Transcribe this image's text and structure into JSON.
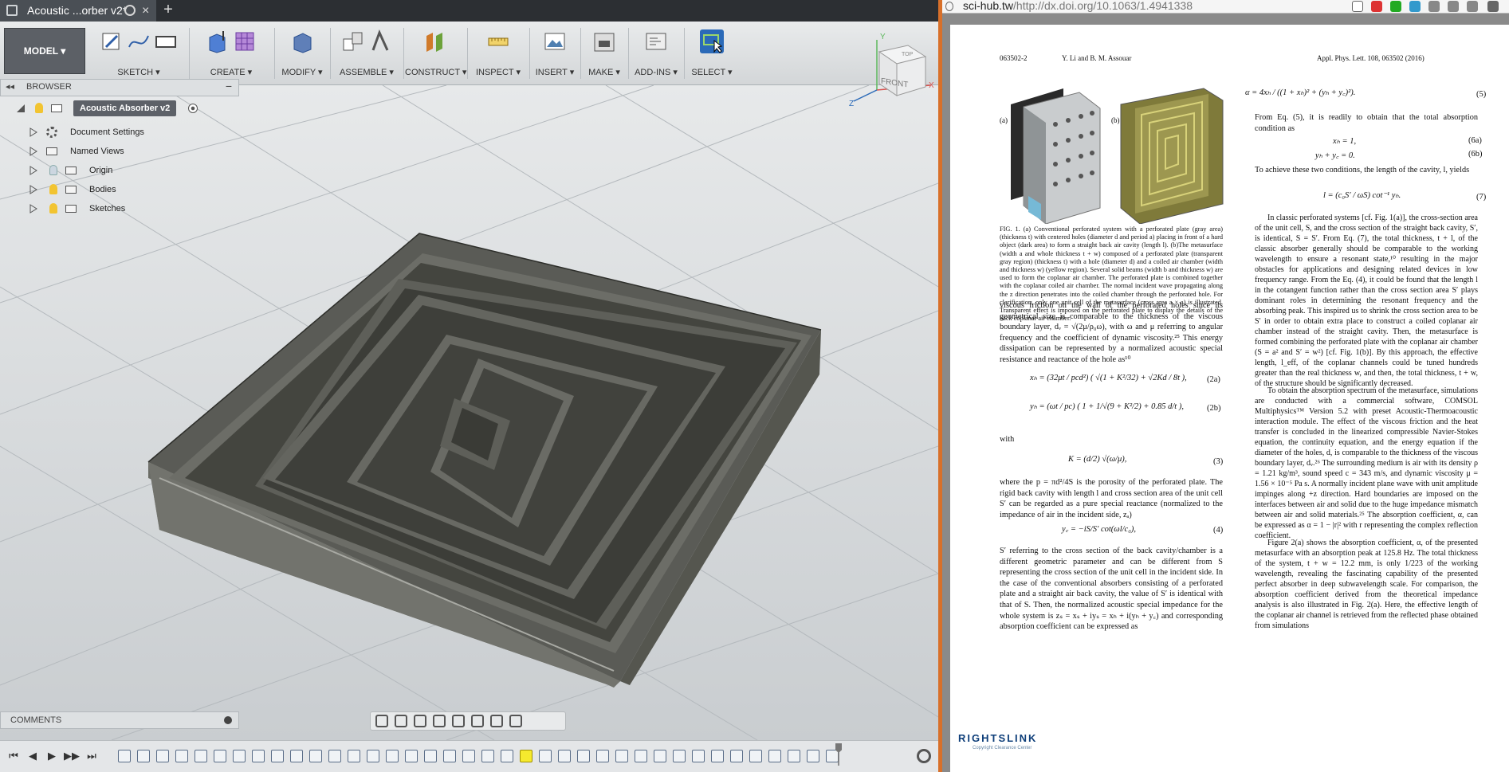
{
  "fusion": {
    "doc_tab_title": "Acoustic ...orber v2*",
    "new_tab": "+",
    "close_glyph": "×",
    "workspace": "MODEL ▾",
    "toolbar_groups": [
      {
        "id": "sketch",
        "label": "SKETCH ▾",
        "color": "#3a66b0"
      },
      {
        "id": "create",
        "label": "CREATE ▾",
        "color": "#4f7fd4"
      },
      {
        "id": "modify",
        "label": "MODIFY ▾",
        "color": "#5f7fb8"
      },
      {
        "id": "assemble",
        "label": "ASSEMBLE ▾",
        "color": "#6e7c8a"
      },
      {
        "id": "construct",
        "label": "CONSTRUCT ▾",
        "color": "#d07a2a"
      },
      {
        "id": "inspect",
        "label": "INSPECT ▾",
        "color": "#c89a2a"
      },
      {
        "id": "insert",
        "label": "INSERT ▾",
        "color": "#4f7fb0"
      },
      {
        "id": "make",
        "label": "MAKE ▾",
        "color": "#555d66"
      },
      {
        "id": "addins",
        "label": "ADD-INS ▾",
        "color": "#555d66"
      },
      {
        "id": "select",
        "label": "SELECT ▾",
        "color": "#2b6ab8"
      }
    ],
    "viewcube": {
      "face": "FRONT",
      "top": "TOP",
      "axis_x": "X",
      "axis_y": "Y",
      "axis_z": "Z"
    },
    "browser": {
      "label": "BROWSER",
      "collapse_glyph": "◂◂",
      "minus_glyph": "−",
      "root": "Acoustic Absorber v2",
      "items": [
        {
          "label": "Document Settings"
        },
        {
          "label": "Named Views"
        },
        {
          "label": "Origin"
        },
        {
          "label": "Bodies"
        },
        {
          "label": "Sketches"
        }
      ]
    },
    "comments_label": "COMMENTS",
    "timeline": {
      "first": "⏮",
      "prev": "◀",
      "play": "▶",
      "next": "▶▶",
      "last": "⏭"
    }
  },
  "pdf": {
    "url_host": "sci-hub.tw",
    "url_rest": "/http://dx.doi.org/10.1063/1.4941338",
    "header_left": "063502-2",
    "header_authors": "Y. Li and B. M. Assouar",
    "header_right": "Appl. Phys. Lett. 108, 063502 (2016)",
    "fig_label_a": "(a)",
    "fig_label_b": "(b)",
    "caption": "FIG. 1. (a) Conventional perforated system with a perforated plate (gray area) (thickness t) with centered holes (diameter d and period a) placing in front of a hard object (dark area) to form a straight back air cavity (length l). (b)The metasurface (width a and whole thickness t + w) composed of a perforated plate (transparent gray region) (thickness t) with a hole (diameter d) and a coiled air chamber (width and thickness w) (yellow region). Several solid beams (width b and thickness w) are used to form the coplanar air chamber. The perforated plate is combined together with the coplanar coiled air chamber. The normal incident wave propagating along the z direction penetrates into the coiled chamber through the perforated hole. For clarification, only one unit cell of the metasurface (cross area a × a) is illustrated. Transparent effect is imposed on the perforated plate to display the details of the back coplanar air chamber.",
    "left_p1": "viscous friction on the wall of the perforated holes since its geometrical size is comparable to the thickness of the viscous boundary layer, dᵥ = √(2μ/ρ₀ω), with ω and μ referring to angular frequency and the coefficient of dynamic viscosity.²⁵ This energy dissipation can be represented by a normalized acoustic special resistance and reactance of the hole as¹⁰",
    "eq2a": "xₕ = (32μt / pcd²) ( √(1 + K²/32) + √2Kd / 8t ),",
    "eq2a_num": "(2a)",
    "eq2b": "yₕ = (ωt / pc) ( 1 + 1/√(9 + K²/2) + 0.85 d/t ),",
    "eq2b_num": "(2b)",
    "with": "with",
    "eq3": "K = (d/2) √(ω/μ),",
    "eq3_num": "(3)",
    "left_p2": "where the p = πd²/4S is the porosity of the perforated plate. The rigid back cavity with length l and cross section area of the unit cell S′ can be regarded as a pure special reactance (normalized to the impedance of air in the incident side, zₐ)",
    "eq4": "y꜀ = −iS/S′ cot(ωl/c₀),",
    "eq4_num": "(4)",
    "left_p3": "S′ referring to the cross section of the back cavity/chamber is a different geometric parameter and can be different from S representing the cross section of the unit cell in the incident side. In the case of the conventional absorbers consisting of a perforated plate and a straight air back cavity, the value of S′ is identical with that of S. Then, the normalized acoustic special impedance for the whole system is zₛ = xₛ + iyₛ = xₕ + i(yₕ + y꜀) and corresponding absorption coefficient can be expressed as",
    "eq5": "α = 4xₕ / ((1 + xₕ)² + (yₕ + y꜀)²).",
    "eq5_num": "(5)",
    "right_p1": "From Eq. (5), it is readily to obtain that the total absorption condition as",
    "eq6a": "xₕ = 1,",
    "eq6a_num": "(6a)",
    "eq6b": "yₕ + y꜀ = 0.",
    "eq6b_num": "(6b)",
    "right_p2": "To achieve these two conditions, the length of the cavity, l, yields",
    "eq7": "l = (c₀S′ / ωS) cot⁻¹ yₕ.",
    "eq7_num": "(7)",
    "right_p3": "In classic perforated systems [cf. Fig. 1(a)], the cross-section area of the unit cell, S, and the cross section of the straight back cavity, S′, is identical, S = S′. From Eq. (7), the total thickness, t + l, of the classic absorber generally should be comparable to the working wavelength to ensure a resonant state,¹⁰ resulting in the major obstacles for applications and designing related devices in low frequency range. From the Eq. (4), it could be found that the length l in the cotangent function rather than the cross section area S′ plays dominant roles in determining the resonant frequency and the absorbing peak. This inspired us to shrink the cross section area to be S′ in order to obtain extra place to construct a coiled coplanar air chamber instead of the straight cavity. Then, the metasurface is formed combining the perforated plate with the coplanar air chamber (S = a² and S′ = w²) [cf. Fig. 1(b)]. By this approach, the effective length, l_eff, of the coplanar channels could be tuned hundreds greater than the real thickness w, and then, the total thickness, t + w, of the structure should be significantly decreased.",
    "right_p4": "To obtain the absorption spectrum of the metasurface, simulations are conducted with a commercial software, COMSOL Multiphysics™ Version 5.2 with preset Acoustic-Thermoacoustic interaction module. The effect of the viscous friction and the heat transfer is concluded in the linearized compressible Navier-Stokes equation, the continuity equation, and the energy equation if the diameter of the holes, d, is comparable to the thickness of the viscous boundary layer, dᵥ.²⁶ The surrounding medium is air with its density ρ = 1.21 kg/m³, sound speed c = 343 m/s, and dynamic viscosity μ = 1.56 × 10⁻⁵ Pa s. A normally incident plane wave with unit amplitude impinges along +z direction. Hard boundaries are imposed on the interfaces between air and solid due to the huge impedance mismatch between air and solid materials.²⁵ The absorption coefficient, α, can be expressed as α = 1 − |r|² with r representing the complex reflection coefficient.",
    "right_p5": "Figure 2(a) shows the absorption coefficient, α, of the presented metasurface with an absorption peak at 125.8 Hz. The total thickness of the system, t + w = 12.2 mm, is only 1/223 of the working wavelength, revealing the fascinating capability of the presented perfect absorber in deep subwavelength scale. For comparison, the absorption coefficient derived from the theoretical impedance analysis is also illustrated in Fig. 2(a). Here, the effective length of the coplanar air channel is retrieved from the reflected phase obtained from simulations",
    "logo": "RIGHTSLINK",
    "logo_sub": "Copyright Clearance Center"
  }
}
